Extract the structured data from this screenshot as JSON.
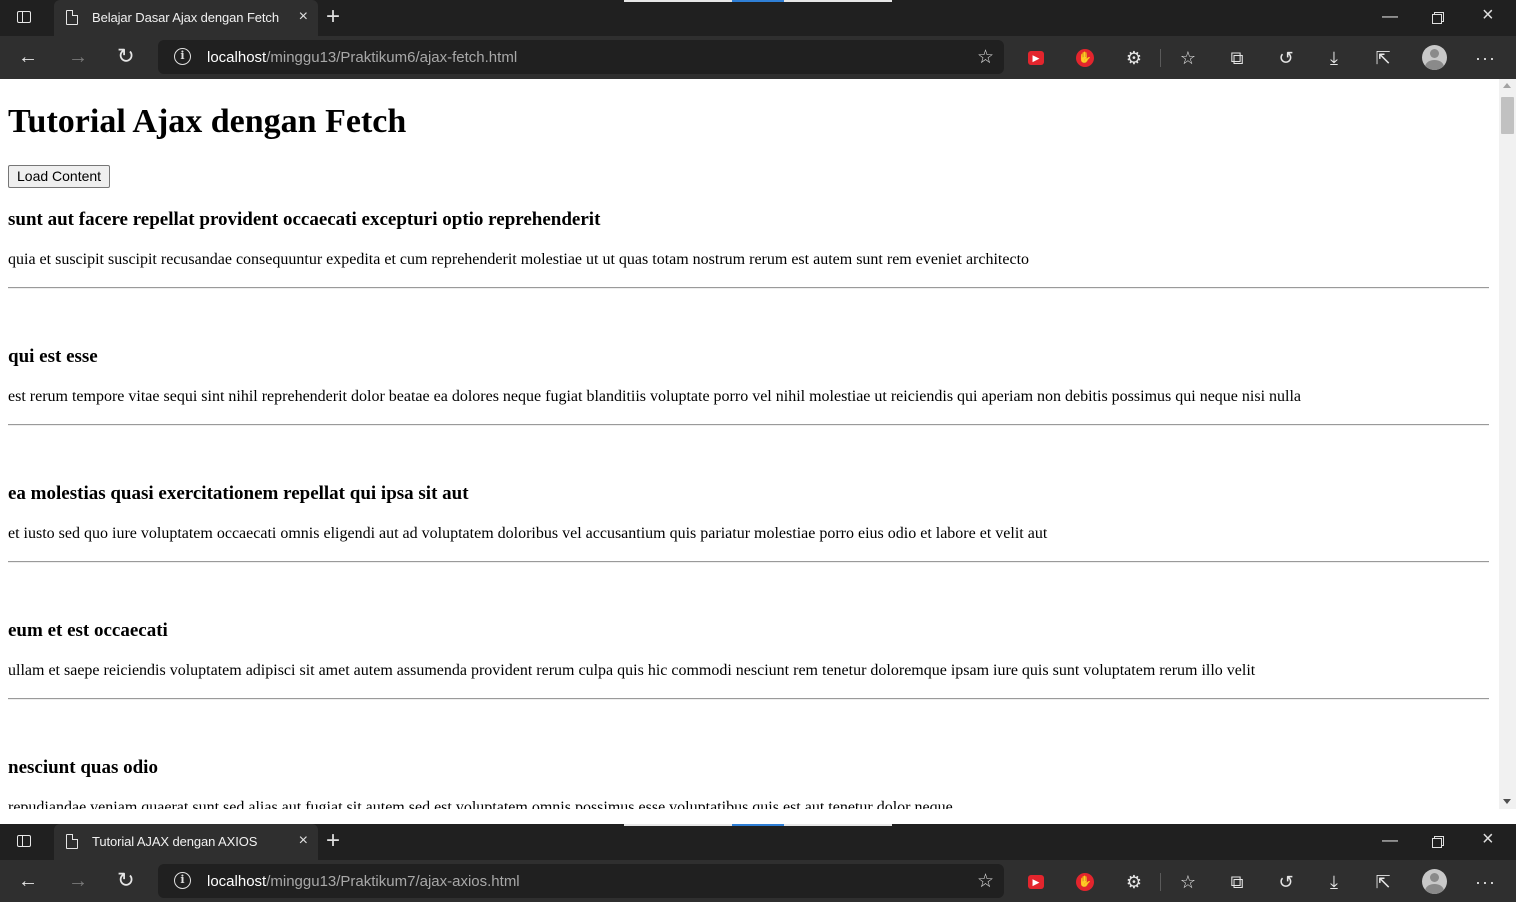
{
  "windows": [
    {
      "tab_title": "Belajar Dasar Ajax dengan Fetch",
      "url_host": "localhost",
      "url_path": "/minggu13/Praktikum6/ajax-fetch.html"
    },
    {
      "tab_title": "Tutorial AJAX dengan AXIOS",
      "url_host": "localhost",
      "url_path": "/minggu13/Praktikum7/ajax-axios.html"
    }
  ],
  "icons": {
    "close": "×",
    "new_tab": "+",
    "minimize": "—",
    "back": "←",
    "forward": "→",
    "refresh": "↻",
    "info": "i",
    "add_favorite": "☆",
    "extension_red": "▶",
    "extension_hand": "✋",
    "extensions": "⚙",
    "favorites": "☆",
    "collections": "⧉",
    "history": "↺",
    "downloads": "⤓",
    "share": "⇱",
    "more": "···"
  },
  "page": {
    "heading": "Tutorial Ajax dengan Fetch",
    "load_button": "Load Content",
    "posts": [
      {
        "title": "sunt aut facere repellat provident occaecati excepturi optio reprehenderit",
        "body": "quia et suscipit suscipit recusandae consequuntur expedita et cum reprehenderit molestiae ut ut quas totam nostrum rerum est autem sunt rem eveniet architecto"
      },
      {
        "title": "qui est esse",
        "body": "est rerum tempore vitae sequi sint nihil reprehenderit dolor beatae ea dolores neque fugiat blanditiis voluptate porro vel nihil molestiae ut reiciendis qui aperiam non debitis possimus qui neque nisi nulla"
      },
      {
        "title": "ea molestias quasi exercitationem repellat qui ipsa sit aut",
        "body": "et iusto sed quo iure voluptatem occaecati omnis eligendi aut ad voluptatem doloribus vel accusantium quis pariatur molestiae porro eius odio et labore et velit aut"
      },
      {
        "title": "eum et est occaecati",
        "body": "ullam et saepe reiciendis voluptatem adipisci sit amet autem assumenda provident rerum culpa quis hic commodi nesciunt rem tenetur doloremque ipsam iure quis sunt voluptatem rerum illo velit"
      },
      {
        "title": "nesciunt quas odio",
        "body": "repudiandae veniam quaerat sunt sed alias aut fugiat sit autem sed est voluptatem omnis possimus esse voluptatibus quis est aut tenetur dolor neque"
      }
    ]
  },
  "colors": {
    "chrome_dark": "#202020",
    "toolbar": "#2f2f2f",
    "extension_red": "#e3252d",
    "accent_blue": "#2f7fd6"
  }
}
